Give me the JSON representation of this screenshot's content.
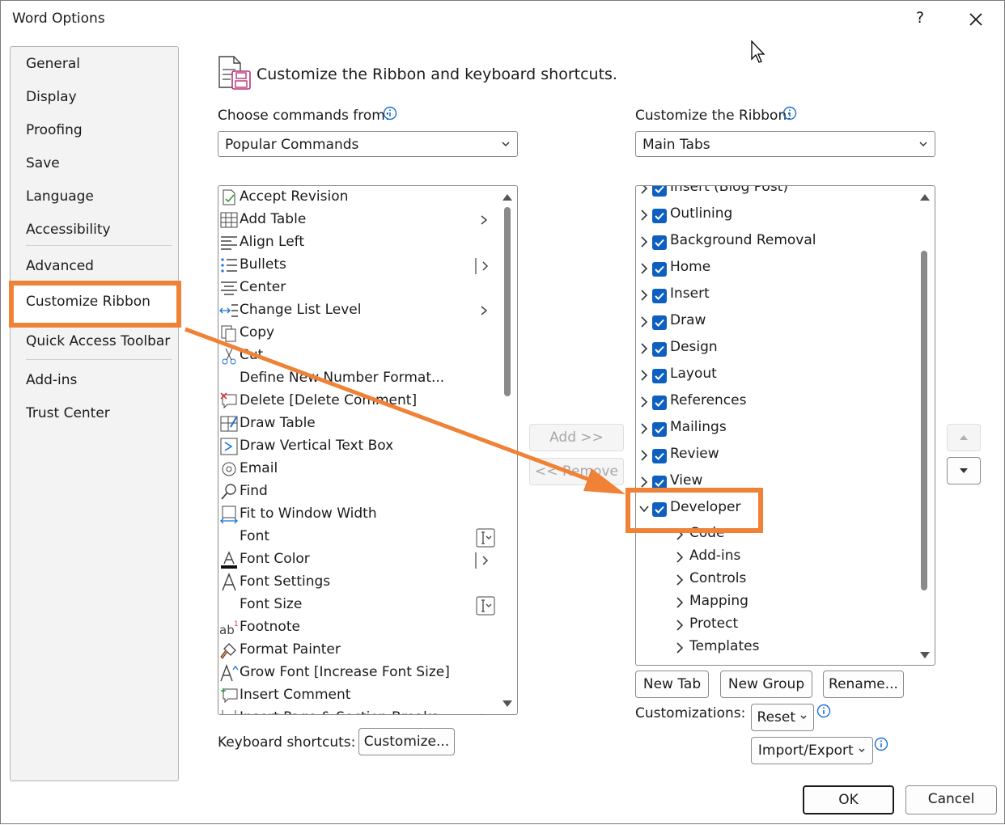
{
  "window": {
    "title": "Word Options",
    "help": "?"
  },
  "sidebar": {
    "items": [
      {
        "label": "General"
      },
      {
        "label": "Display"
      },
      {
        "label": "Proofing"
      },
      {
        "label": "Save"
      },
      {
        "label": "Language"
      },
      {
        "label": "Accessibility"
      },
      {
        "label": "Advanced"
      },
      {
        "label": "Customize Ribbon"
      },
      {
        "label": "Quick Access Toolbar"
      },
      {
        "label": "Add-ins"
      },
      {
        "label": "Trust Center"
      }
    ],
    "selected": "Customize Ribbon"
  },
  "header": {
    "title": "Customize the Ribbon and keyboard shortcuts."
  },
  "left": {
    "label": "Choose commands from:",
    "combo_value": "Popular Commands",
    "commands": [
      {
        "label": "Accept Revision",
        "icon": "accept-revision-icon"
      },
      {
        "label": "Add Table",
        "icon": "table-icon"
      },
      {
        "label": "Align Left",
        "icon": "align-left-icon"
      },
      {
        "label": "Bullets",
        "icon": "bullets-icon"
      },
      {
        "label": "Center",
        "icon": "align-center-icon"
      },
      {
        "label": "Change List Level",
        "icon": "change-list-level-icon"
      },
      {
        "label": "Copy",
        "icon": "copy-icon"
      },
      {
        "label": "Cut",
        "icon": "cut-icon"
      },
      {
        "label": "Define New Number Format...",
        "icon": ""
      },
      {
        "label": "Delete [Delete Comment]",
        "icon": "delete-comment-icon"
      },
      {
        "label": "Draw Table",
        "icon": "draw-table-icon"
      },
      {
        "label": "Draw Vertical Text Box",
        "icon": "vertical-text-box-icon"
      },
      {
        "label": "Email",
        "icon": "email-icon"
      },
      {
        "label": "Find",
        "icon": "find-icon"
      },
      {
        "label": "Fit to Window Width",
        "icon": "fit-width-icon"
      },
      {
        "label": "Font",
        "icon": ""
      },
      {
        "label": "Font Color",
        "icon": "font-color-icon"
      },
      {
        "label": "Font Settings",
        "icon": "font-settings-icon"
      },
      {
        "label": "Font Size",
        "icon": ""
      },
      {
        "label": "Footnote",
        "icon": "footnote-icon"
      },
      {
        "label": "Format Painter",
        "icon": "format-painter-icon"
      },
      {
        "label": "Grow Font [Increase Font Size]",
        "icon": "grow-font-icon"
      },
      {
        "label": "Insert Comment",
        "icon": "insert-comment-icon"
      },
      {
        "label": "Insert Page & Section Breaks",
        "icon": "page-break-icon"
      }
    ],
    "shortcuts_label": "Keyboard shortcuts:",
    "customize_button": "Customize..."
  },
  "middle": {
    "add_button": "Add >>",
    "remove_button": "<< Remove"
  },
  "right": {
    "label": "Customize the Ribbon:",
    "combo_value": "Main Tabs",
    "tabs": [
      {
        "label": "Insert (Blog Post)"
      },
      {
        "label": "Outlining"
      },
      {
        "label": "Background Removal"
      },
      {
        "label": "Home"
      },
      {
        "label": "Insert"
      },
      {
        "label": "Draw"
      },
      {
        "label": "Design"
      },
      {
        "label": "Layout"
      },
      {
        "label": "References"
      },
      {
        "label": "Mailings"
      },
      {
        "label": "Review"
      },
      {
        "label": "View"
      },
      {
        "label": "Developer"
      }
    ],
    "developer_groups": [
      {
        "label": "Code"
      },
      {
        "label": "Add-ins"
      },
      {
        "label": "Controls"
      },
      {
        "label": "Mapping"
      },
      {
        "label": "Protect"
      },
      {
        "label": "Templates"
      }
    ],
    "new_tab": "New Tab",
    "new_group": "New Group",
    "rename": "Rename...",
    "customizations_label": "Customizations:",
    "reset": "Reset",
    "import_export": "Import/Export"
  },
  "footer": {
    "ok": "OK",
    "cancel": "Cancel"
  },
  "colors": {
    "accent_orange": "#f08237",
    "checkbox_blue": "#0f5fc0",
    "info_blue": "#1a6fd6"
  }
}
